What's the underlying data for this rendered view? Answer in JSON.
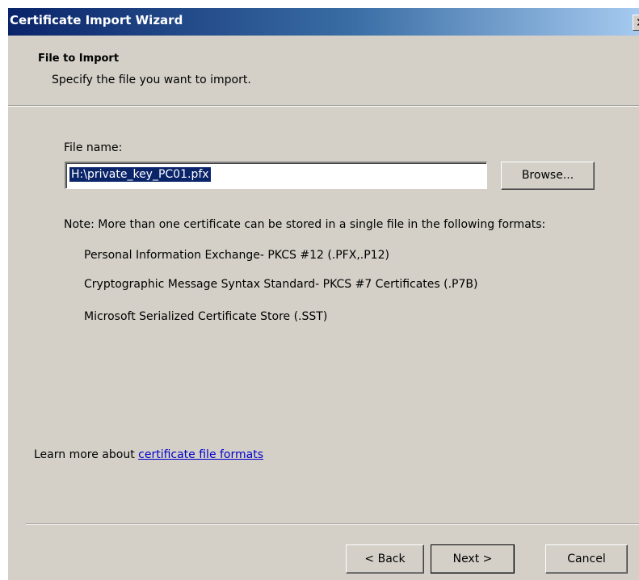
{
  "window": {
    "title": "Certificate Import Wizard",
    "close_label": "✕"
  },
  "header": {
    "title": "File to Import",
    "subtitle": "Specify the file you want to import."
  },
  "file": {
    "label": "File name:",
    "value": "H:\\private_key_PC01.pfx",
    "browse_label": "Browse..."
  },
  "note": {
    "text": "Note:  More than one certificate can be stored in a single file in the following formats:",
    "formats": [
      "Personal Information Exchange- PKCS #12 (.PFX,.P12)",
      "Cryptographic Message Syntax Standard- PKCS #7 Certificates (.P7B)",
      "Microsoft Serialized Certificate Store (.SST)"
    ]
  },
  "learn_more": {
    "prefix": "Learn more about ",
    "link": "certificate file formats"
  },
  "footer": {
    "back_label": "< Back",
    "next_label": "Next >",
    "cancel_label": "Cancel"
  },
  "colors": {
    "titlebar_start": "#0a246a",
    "titlebar_end": "#a6caf0",
    "dialog_bg": "#d4d0c8",
    "selection": "#0a246a",
    "link": "#0000cc"
  }
}
